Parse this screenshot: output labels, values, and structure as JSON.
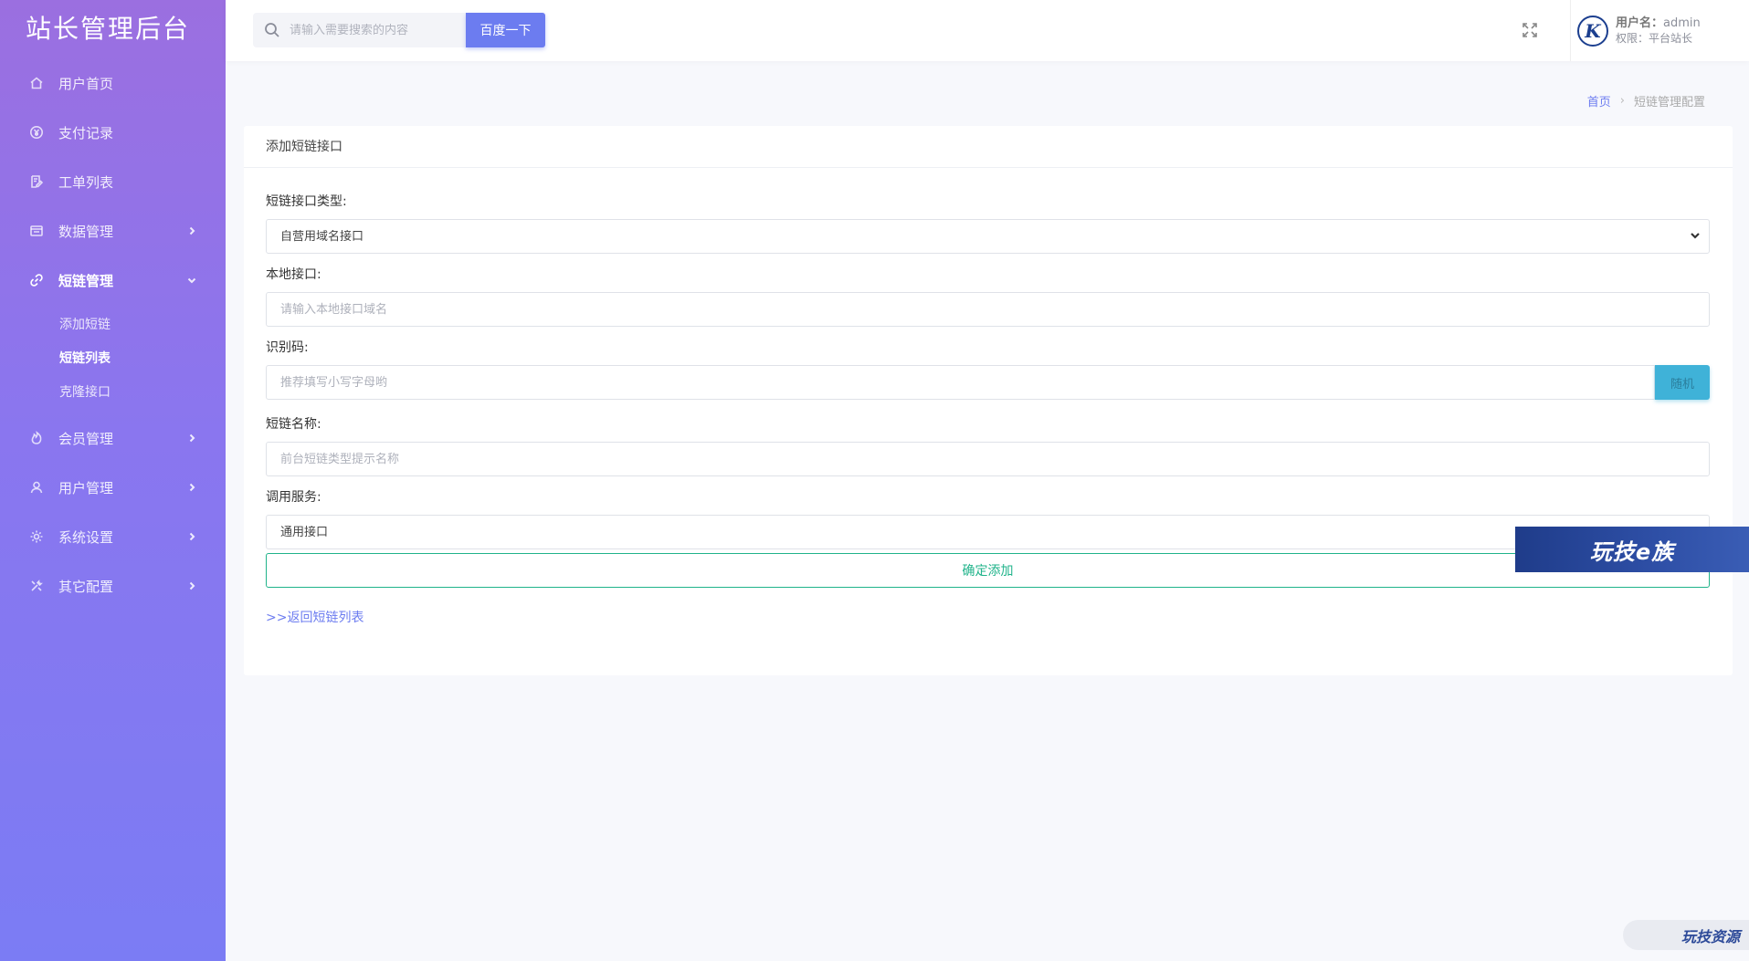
{
  "app": {
    "title": "站长管理后台"
  },
  "sidebar": {
    "items": [
      {
        "label": "用户首页",
        "icon": "home-icon",
        "has_arrow": false
      },
      {
        "label": "支付记录",
        "icon": "yen-icon",
        "has_arrow": false
      },
      {
        "label": "工单列表",
        "icon": "ticket-icon",
        "has_arrow": false
      },
      {
        "label": "数据管理",
        "icon": "database-icon",
        "has_arrow": true
      },
      {
        "label": "短链管理",
        "icon": "link-icon",
        "has_arrow": true,
        "expanded": true
      },
      {
        "label": "会员管理",
        "icon": "flame-icon",
        "has_arrow": true
      },
      {
        "label": "用户管理",
        "icon": "user-icon",
        "has_arrow": true
      },
      {
        "label": "系统设置",
        "icon": "gear-icon",
        "has_arrow": true
      },
      {
        "label": "其它配置",
        "icon": "tools-icon",
        "has_arrow": true
      }
    ],
    "submenu": [
      {
        "label": "添加短链"
      },
      {
        "label": "短链列表"
      },
      {
        "label": "克隆接口"
      }
    ]
  },
  "topbar": {
    "search_placeholder": "请输入需要搜索的内容",
    "search_button": "百度一下",
    "username_label": "用户名：",
    "username": "admin",
    "role": "权限：平台站长",
    "avatar_letter": "K"
  },
  "breadcrumb": {
    "home": "首页",
    "sep": "›",
    "current": "短链管理配置"
  },
  "card": {
    "title": "添加短链接口",
    "type_label": "短链接口类型:",
    "type_selected": "自营用域名接口",
    "local_label": "本地接口:",
    "local_placeholder": "请输入本地接口域名",
    "code_label": "识别码:",
    "code_placeholder": "推荐填写小写字母哟",
    "random_button": "随机",
    "name_label": "短链名称:",
    "name_placeholder": "前台短链类型提示名称",
    "service_label": "调用服务:",
    "service_value": "通用接口",
    "submit_button": "确定添加",
    "back_link": ">>返回短链列表"
  },
  "watermarks": {
    "banner": "玩技e族",
    "corner": "玩技资源"
  },
  "colors": {
    "accent": "#6c7cf0",
    "success": "#1fb38a",
    "info": "#3fb2d8",
    "sidebar_top": "#9b6fe0",
    "sidebar_bottom": "#7b7cf4"
  }
}
